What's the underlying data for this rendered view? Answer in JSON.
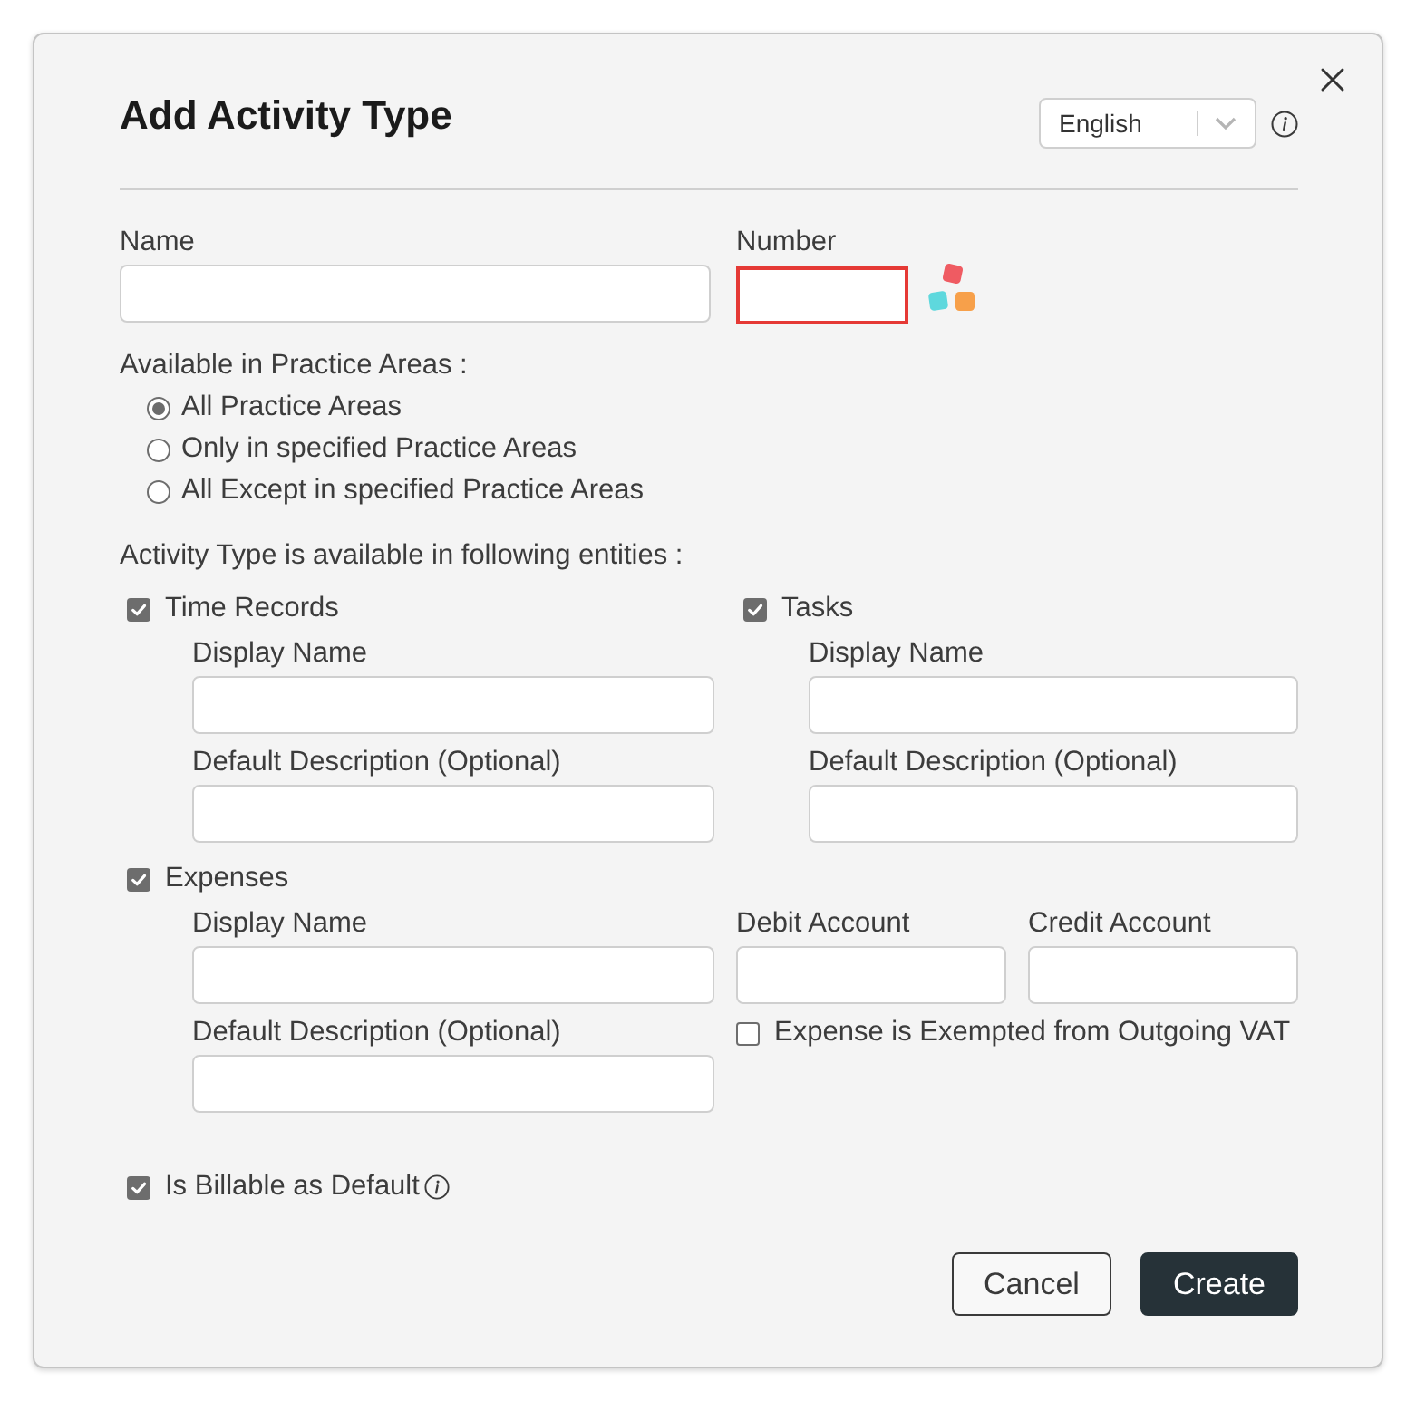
{
  "dialog": {
    "title": "Add Activity Type"
  },
  "language_select": {
    "value": "English"
  },
  "name_field": {
    "label": "Name"
  },
  "number_field": {
    "label": "Number",
    "invalid": true
  },
  "practice_areas": {
    "label": "Available in Practice Areas :",
    "options": [
      {
        "label": "All Practice Areas",
        "selected": true
      },
      {
        "label": "Only in specified Practice Areas",
        "selected": false
      },
      {
        "label": "All Except in specified Practice Areas",
        "selected": false
      }
    ]
  },
  "entities": {
    "label": "Activity Type is available in following entities :",
    "items": [
      {
        "kind": "basic",
        "label": "Time Records",
        "checked": true,
        "fields": [
          {
            "label": "Display Name"
          },
          {
            "label": "Default Description (Optional)"
          }
        ]
      },
      {
        "kind": "basic",
        "label": "Tasks",
        "checked": true,
        "fields": [
          {
            "label": "Display Name"
          },
          {
            "label": "Default Description (Optional)"
          }
        ]
      },
      {
        "kind": "expense",
        "label": "Expenses",
        "checked": true,
        "fields": [
          {
            "label": "Display Name"
          },
          {
            "label": "Default Description (Optional)"
          }
        ],
        "accounts": [
          {
            "label": "Debit Account"
          },
          {
            "label": "Credit Account"
          }
        ],
        "vat_option": {
          "label": "Expense is Exempted from Outgoing VAT",
          "checked": false
        }
      }
    ]
  },
  "billable": {
    "label": "Is Billable as Default",
    "checked": true
  },
  "buttons": [
    {
      "label": "Cancel",
      "kind": "secondary"
    },
    {
      "label": "Create",
      "kind": "primary"
    }
  ]
}
